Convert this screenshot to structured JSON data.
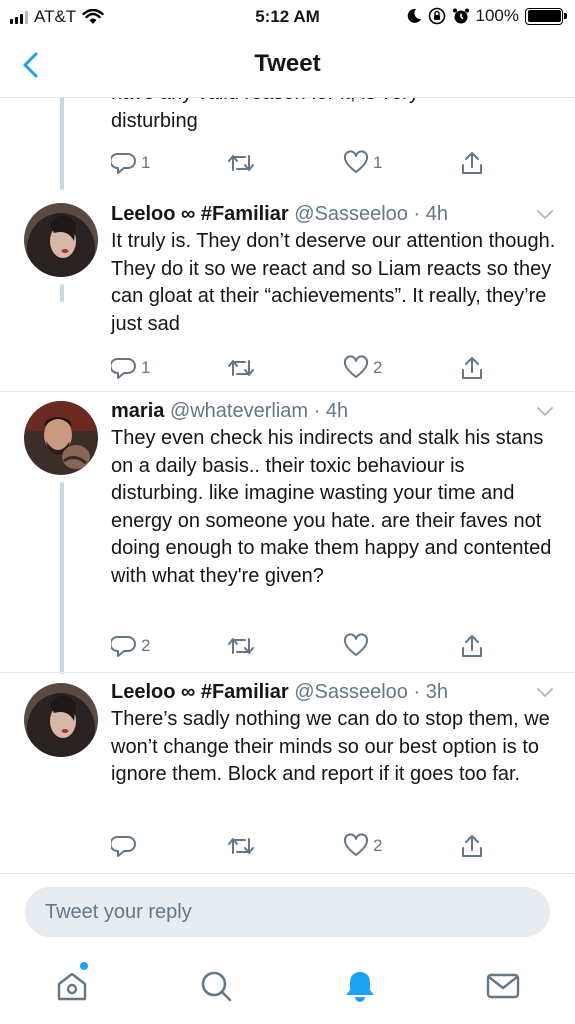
{
  "status_bar": {
    "carrier": "AT&T",
    "time": "5:12 AM",
    "battery": "100%"
  },
  "nav": {
    "title": "Tweet",
    "back_icon": "chevron-left-icon"
  },
  "colors": {
    "accent": "#1da1f2",
    "secondary_text": "#657786",
    "primary_text": "#14171a",
    "divider": "#e6ecf0"
  },
  "tweets": [
    {
      "text_partial": "have any valid reason for it, is very",
      "text": "disturbing",
      "replies": "1",
      "retweets": "",
      "likes": "1"
    },
    {
      "display_name": "Leeloo ∞ #Familiar",
      "handle": "@Sasseeloo",
      "time": "· 4h",
      "text": "It truly is. They don’t deserve our attention though. They do it so we react and so Liam reacts so they can gloat at their “achievements”.  It really, they’re just sad",
      "replies": "1",
      "retweets": "",
      "likes": "2"
    },
    {
      "display_name": "maria",
      "handle": "@whateverliam",
      "time": "· 4h",
      "text": "They even check his indirects and stalk his stans on a daily basis.. their toxic behaviour is disturbing. like imagine wasting your time and energy on someone you hate. are their faves not doing enough to make them happy and contented with what they're given?",
      "replies": "2",
      "retweets": "",
      "likes": ""
    },
    {
      "display_name": "Leeloo ∞ #Familiar",
      "handle": "@Sasseeloo",
      "time": "· 3h",
      "text": "There’s sadly nothing we can do to stop them, we won’t change their minds so our best option is to ignore them. Block and report if it goes too far.",
      "replies": "",
      "retweets": "",
      "likes": "2"
    }
  ],
  "reply": {
    "placeholder": "Tweet your reply"
  },
  "tabs": [
    {
      "icon": "home-icon",
      "has_notification_dot": true
    },
    {
      "icon": "search-icon"
    },
    {
      "icon": "notifications-bell-icon",
      "active": true
    },
    {
      "icon": "messages-envelope-icon"
    }
  ]
}
